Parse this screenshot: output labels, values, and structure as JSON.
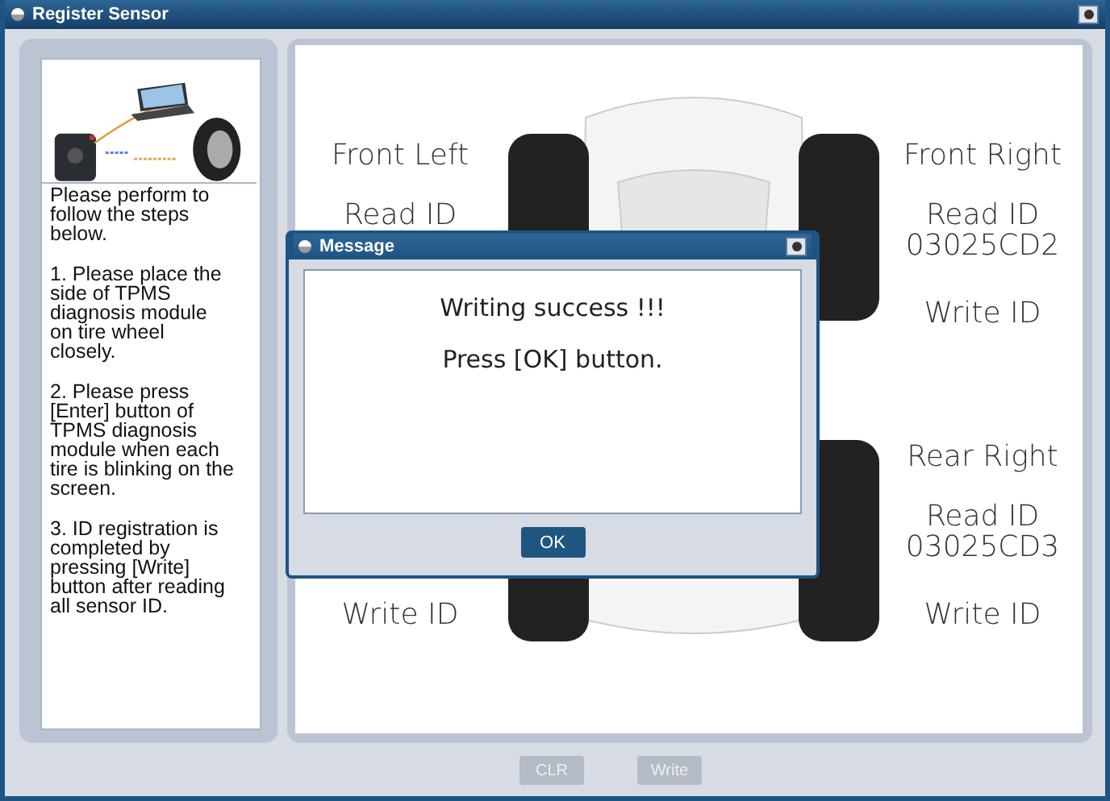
{
  "window": {
    "title": "Register Sensor"
  },
  "instructions": [
    "Please perform to follow the steps below.",
    "1. Please place the side of TPMS diagnosis module on tire wheel closely.",
    "2. Please press [Enter] button of TPMS diagnosis module when each tire is blinking on the screen.",
    "3. ID registration is completed by pressing [Write] button after reading all sensor ID."
  ],
  "left_column": {
    "front": [
      {
        "kind": "position",
        "text": "Front Left"
      },
      {
        "kind": "read",
        "text": "Read ID"
      }
    ],
    "rear": [
      {
        "kind": "write",
        "text": "Write ID"
      }
    ]
  },
  "right_column": {
    "front": [
      {
        "kind": "position",
        "text": "Front Right"
      },
      {
        "kind": "read",
        "text": "Read ID"
      },
      {
        "kind": "id",
        "text": "03025CD2"
      },
      {
        "kind": "write",
        "text": "Write ID"
      }
    ],
    "rear": [
      {
        "kind": "position",
        "text": "Rear Right"
      },
      {
        "kind": "read",
        "text": "Read ID"
      },
      {
        "kind": "id",
        "text": "03025CD3"
      },
      {
        "kind": "write",
        "text": "Write ID"
      }
    ]
  },
  "buttons": [
    {
      "label": "CLR",
      "disabled": true
    },
    {
      "label": "Write",
      "disabled": true
    }
  ],
  "dialog": {
    "title": "Message",
    "lines": [
      "Writing success !!!",
      "Press [OK] button."
    ],
    "ok_button": "OK"
  }
}
